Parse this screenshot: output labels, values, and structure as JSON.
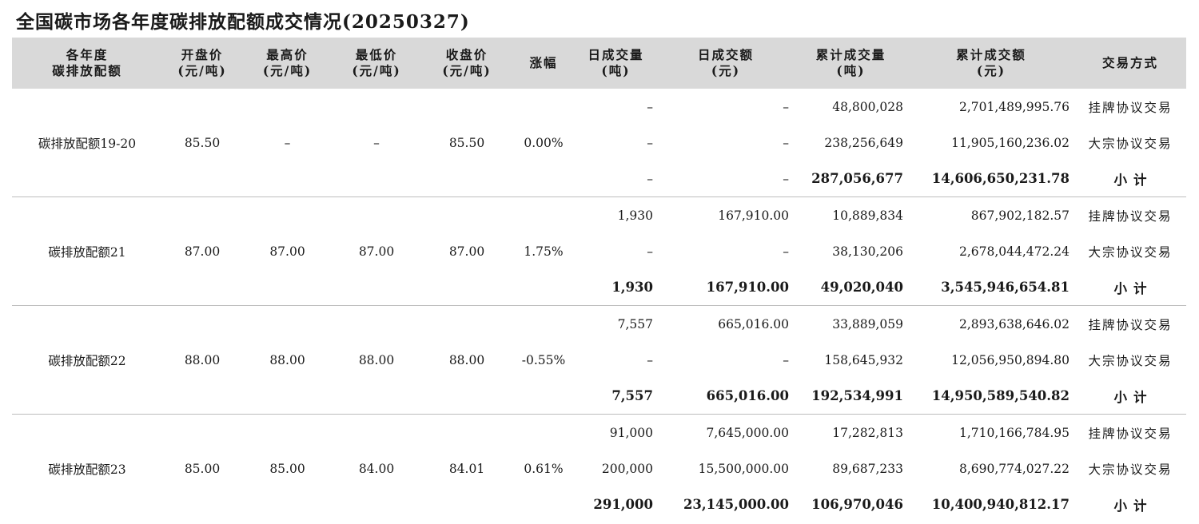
{
  "title": "全国碳市场各年度碳排放配额成交情况(20250327)",
  "headers": [
    {
      "line1": "各年度",
      "line2": "碳排放配额"
    },
    {
      "line1": "开盘价",
      "line2": "(元/吨)"
    },
    {
      "line1": "最高价",
      "line2": "(元/吨)"
    },
    {
      "line1": "最低价",
      "line2": "(元/吨)"
    },
    {
      "line1": "收盘价",
      "line2": "(元/吨)"
    },
    {
      "line1": "涨幅",
      "line2": ""
    },
    {
      "line1": "日成交量",
      "line2": "(吨)"
    },
    {
      "line1": "日成交额",
      "line2": "(元)"
    },
    {
      "line1": "累计成交量",
      "line2": "(吨)"
    },
    {
      "line1": "累计成交额",
      "line2": "(元)"
    },
    {
      "line1": "交易方式",
      "line2": ""
    }
  ],
  "groups": [
    {
      "name": "碳排放配额19-20",
      "open": "85.50",
      "high": "–",
      "low": "–",
      "close": "85.50",
      "change": "0.00%",
      "rows": [
        {
          "daily_vol": "–",
          "daily_amt": "–",
          "cum_vol": "48,800,028",
          "cum_amt": "2,701,489,995.76",
          "method": "挂牌协议交易"
        },
        {
          "daily_vol": "–",
          "daily_amt": "–",
          "cum_vol": "238,256,649",
          "cum_amt": "11,905,160,236.02",
          "method": "大宗协议交易"
        },
        {
          "daily_vol": "–",
          "daily_amt": "–",
          "cum_vol": "287,056,677",
          "cum_amt": "14,606,650,231.78",
          "method": "小计"
        }
      ]
    },
    {
      "name": "碳排放配额21",
      "open": "87.00",
      "high": "87.00",
      "low": "87.00",
      "close": "87.00",
      "change": "1.75%",
      "rows": [
        {
          "daily_vol": "1,930",
          "daily_amt": "167,910.00",
          "cum_vol": "10,889,834",
          "cum_amt": "867,902,182.57",
          "method": "挂牌协议交易"
        },
        {
          "daily_vol": "–",
          "daily_amt": "–",
          "cum_vol": "38,130,206",
          "cum_amt": "2,678,044,472.24",
          "method": "大宗协议交易"
        },
        {
          "daily_vol": "1,930",
          "daily_amt": "167,910.00",
          "cum_vol": "49,020,040",
          "cum_amt": "3,545,946,654.81",
          "method": "小计"
        }
      ]
    },
    {
      "name": "碳排放配额22",
      "open": "88.00",
      "high": "88.00",
      "low": "88.00",
      "close": "88.00",
      "change": "-0.55%",
      "rows": [
        {
          "daily_vol": "7,557",
          "daily_amt": "665,016.00",
          "cum_vol": "33,889,059",
          "cum_amt": "2,893,638,646.02",
          "method": "挂牌协议交易"
        },
        {
          "daily_vol": "–",
          "daily_amt": "–",
          "cum_vol": "158,645,932",
          "cum_amt": "12,056,950,894.80",
          "method": "大宗协议交易"
        },
        {
          "daily_vol": "7,557",
          "daily_amt": "665,016.00",
          "cum_vol": "192,534,991",
          "cum_amt": "14,950,589,540.82",
          "method": "小计"
        }
      ]
    },
    {
      "name": "碳排放配额23",
      "open": "85.00",
      "high": "85.00",
      "low": "84.00",
      "close": "84.01",
      "change": "0.61%",
      "rows": [
        {
          "daily_vol": "91,000",
          "daily_amt": "7,645,000.00",
          "cum_vol": "17,282,813",
          "cum_amt": "1,710,166,784.95",
          "method": "挂牌协议交易"
        },
        {
          "daily_vol": "200,000",
          "daily_amt": "15,500,000.00",
          "cum_vol": "89,687,233",
          "cum_amt": "8,690,774,027.22",
          "method": "大宗协议交易"
        },
        {
          "daily_vol": "291,000",
          "daily_amt": "23,145,000.00",
          "cum_vol": "106,970,046",
          "cum_amt": "10,400,940,812.17",
          "method": "小计"
        }
      ]
    }
  ]
}
